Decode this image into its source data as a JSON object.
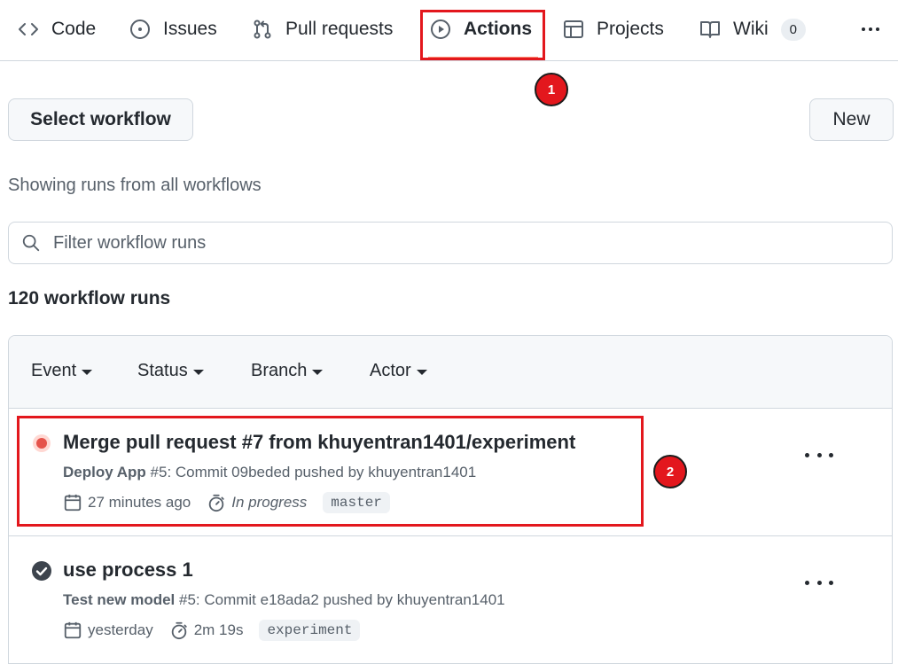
{
  "nav": {
    "code": "Code",
    "issues": "Issues",
    "pull_requests": "Pull requests",
    "actions": "Actions",
    "projects": "Projects",
    "wiki": "Wiki",
    "wiki_count": "0"
  },
  "annotations": {
    "marker_1": "1",
    "marker_2": "2"
  },
  "toolbar": {
    "select_workflow": "Select workflow",
    "new": "New"
  },
  "subtitle": "Showing runs from all workflows",
  "filter": {
    "placeholder": "Filter workflow runs"
  },
  "runs_count": "120 workflow runs",
  "filters": {
    "event": "Event",
    "status": "Status",
    "branch": "Branch",
    "actor": "Actor"
  },
  "runs": [
    {
      "title": "Merge pull request #7 from khuyentran1401/experiment",
      "workflow": "Deploy App",
      "detail": " #5: Commit 09beded pushed by khuyentran1401",
      "time": "27 minutes ago",
      "duration": "In progress",
      "branch": "master",
      "status": "in-progress"
    },
    {
      "title": "use process 1",
      "workflow": "Test new model",
      "detail": " #5: Commit e18ada2 pushed by khuyentran1401",
      "time": "yesterday",
      "duration": "2m 19s",
      "branch": "experiment",
      "status": "success"
    }
  ],
  "colors": {
    "accent_red": "#e3171d",
    "border": "#d0d7de",
    "muted": "#57606a",
    "text": "#24292f"
  }
}
